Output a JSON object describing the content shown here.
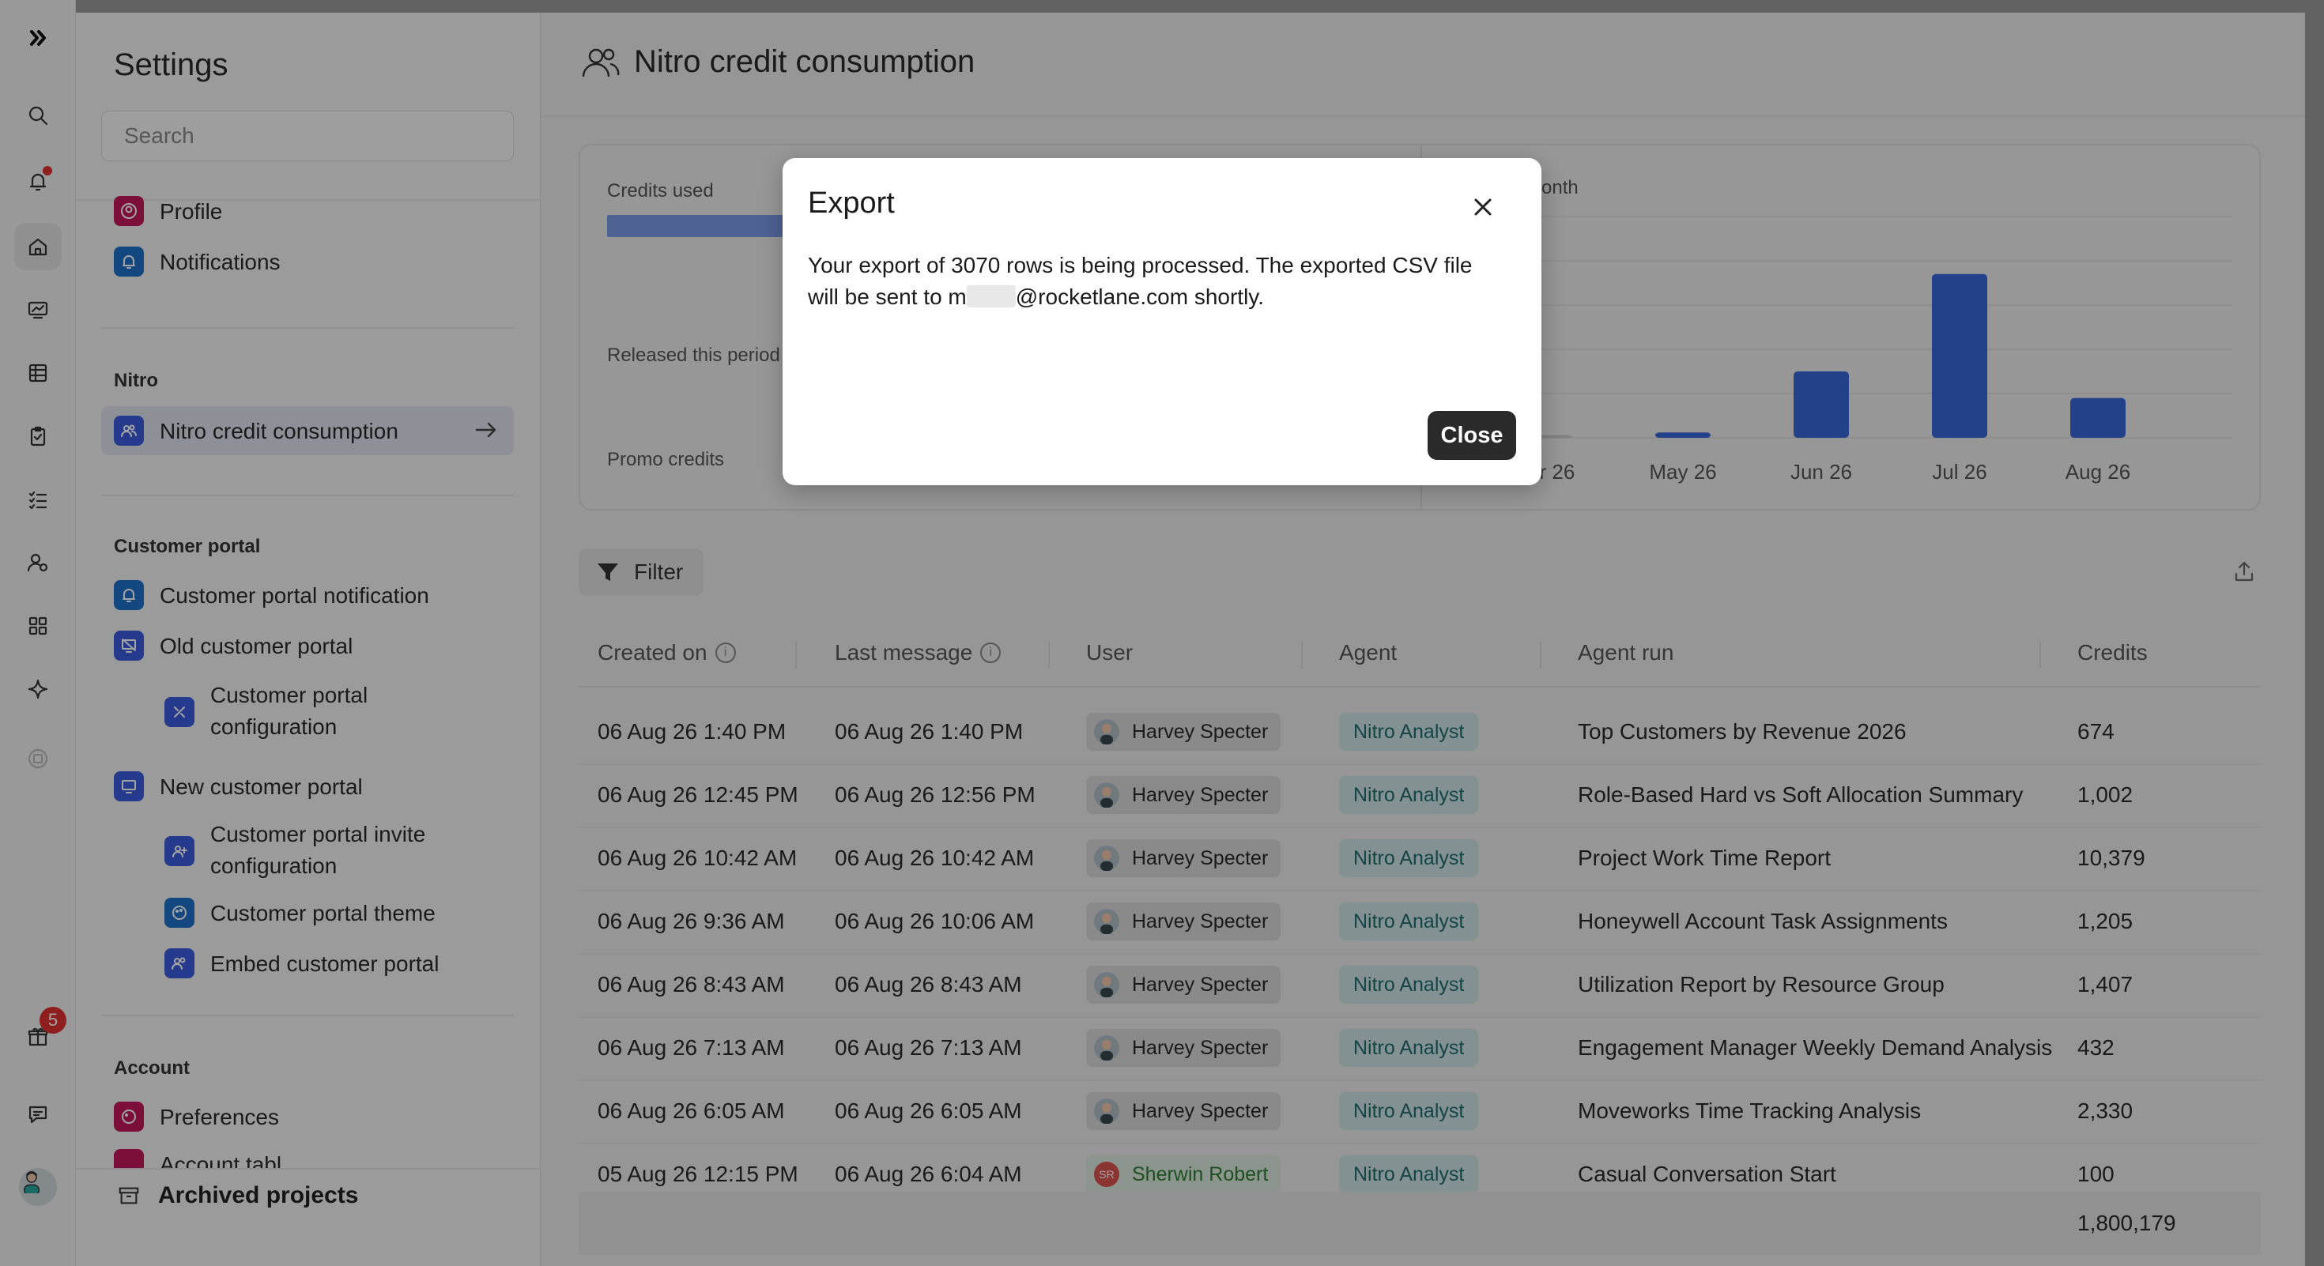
{
  "rail": {
    "icons": [
      "logo-icon",
      "search-icon",
      "bell-icon",
      "home-icon",
      "monitor-chart-icon",
      "table-icon",
      "clipboard-icon",
      "checklist-icon",
      "user-gear-icon",
      "grid-icon",
      "sparkle-icon",
      "box-icon",
      "gift-icon",
      "chat-icon"
    ],
    "gift_badge": "5"
  },
  "settings": {
    "title": "Settings",
    "search_placeholder": "Search",
    "items_top": [
      {
        "label": "Profile",
        "color": "#c2185b"
      },
      {
        "label": "Notifications",
        "color": "#1e6fc9"
      }
    ],
    "nitro_heading": "Nitro",
    "nitro_item": {
      "label": "Nitro credit consumption",
      "color": "#3b5bdb"
    },
    "portal_heading": "Customer portal",
    "portal_items": [
      {
        "label": "Customer portal notification",
        "color": "#1e6fc9"
      },
      {
        "label": "Old customer portal",
        "color": "#3b5bdb"
      },
      {
        "label_1": "Customer portal",
        "label_2": "configuration",
        "color": "#3b5bdb"
      },
      {
        "label": "New customer portal",
        "color": "#3b5bdb"
      },
      {
        "label_1": "Customer portal invite",
        "label_2": "configuration",
        "color": "#3b5bdb"
      },
      {
        "label": "Customer portal theme",
        "color": "#1e6fc9"
      },
      {
        "label": "Embed customer portal",
        "color": "#3b5bdb"
      }
    ],
    "account_heading": "Account",
    "account_items": [
      {
        "label": "Preferences",
        "color": "#c2185b"
      },
      {
        "label": "Account tabl",
        "color": "#c2185b"
      }
    ],
    "archived": "Archived projects"
  },
  "main": {
    "title": "Nitro credit consumption",
    "kpis": {
      "credits_used": "Credits used",
      "released": "Released this period",
      "promo": "Promo credits"
    },
    "chart_title": "nsumed by month",
    "filter_label": "Filter",
    "columns": {
      "created_on": "Created on",
      "last_message": "Last message",
      "user": "User",
      "agent": "Agent",
      "agent_run": "Agent run",
      "credits": "Credits"
    },
    "rows": [
      {
        "created": "06 Aug 26 1:40 PM",
        "last": "06 Aug 26 1:40 PM",
        "user": "Harvey Specter",
        "agent": "Nitro Analyst",
        "run": "Top Customers by Revenue 2026",
        "credits": "674"
      },
      {
        "created": "06 Aug 26 12:45 PM",
        "last": "06 Aug 26 12:56 PM",
        "user": "Harvey Specter",
        "agent": "Nitro Analyst",
        "run": "Role-Based Hard vs Soft Allocation Summary",
        "credits": "1,002"
      },
      {
        "created": "06 Aug 26 10:42 AM",
        "last": "06 Aug 26 10:42 AM",
        "user": "Harvey Specter",
        "agent": "Nitro Analyst",
        "run": "Project Work Time Report",
        "credits": "10,379"
      },
      {
        "created": "06 Aug 26 9:36 AM",
        "last": "06 Aug 26 10:06 AM",
        "user": "Harvey Specter",
        "agent": "Nitro Analyst",
        "run": "Honeywell Account Task Assignments",
        "credits": "1,205"
      },
      {
        "created": "06 Aug 26 8:43 AM",
        "last": "06 Aug 26 8:43 AM",
        "user": "Harvey Specter",
        "agent": "Nitro Analyst",
        "run": "Utilization Report by Resource Group",
        "credits": "1,407"
      },
      {
        "created": "06 Aug 26 7:13 AM",
        "last": "06 Aug 26 7:13 AM",
        "user": "Harvey Specter",
        "agent": "Nitro Analyst",
        "run": "Engagement Manager Weekly Demand Analysis",
        "credits": "432"
      },
      {
        "created": "06 Aug 26 6:05 AM",
        "last": "06 Aug 26 6:05 AM",
        "user": "Harvey Specter",
        "agent": "Nitro Analyst",
        "run": "Moveworks Time Tracking Analysis",
        "credits": "2,330"
      },
      {
        "created": "05 Aug 26 12:15 PM",
        "last": "06 Aug 26 6:04 AM",
        "user": "Sherwin Robert",
        "user_initials": "SR",
        "agent": "Nitro Analyst",
        "run": "Casual Conversation Start",
        "credits": "100"
      }
    ],
    "total_credits": "1,800,179"
  },
  "chart_data": {
    "type": "bar",
    "categories": [
      "Apr 26",
      "May 26",
      "Jun 26",
      "Jul 26",
      "Aug 26"
    ],
    "values": [
      0.3,
      0.6,
      7.5,
      18.5,
      4.5
    ],
    "ylim": [
      0,
      25
    ],
    "grid": true,
    "bar_color": "#3867d6",
    "zero_bar_color": "#cccccc"
  },
  "modal": {
    "title": "Export",
    "body_1": "Your export of 3070 rows is being processed. The exported CSV file",
    "body_2_prefix": "will be sent to m",
    "body_2_suffix": "@rocketlane.com shortly.",
    "close_label": "Close"
  }
}
